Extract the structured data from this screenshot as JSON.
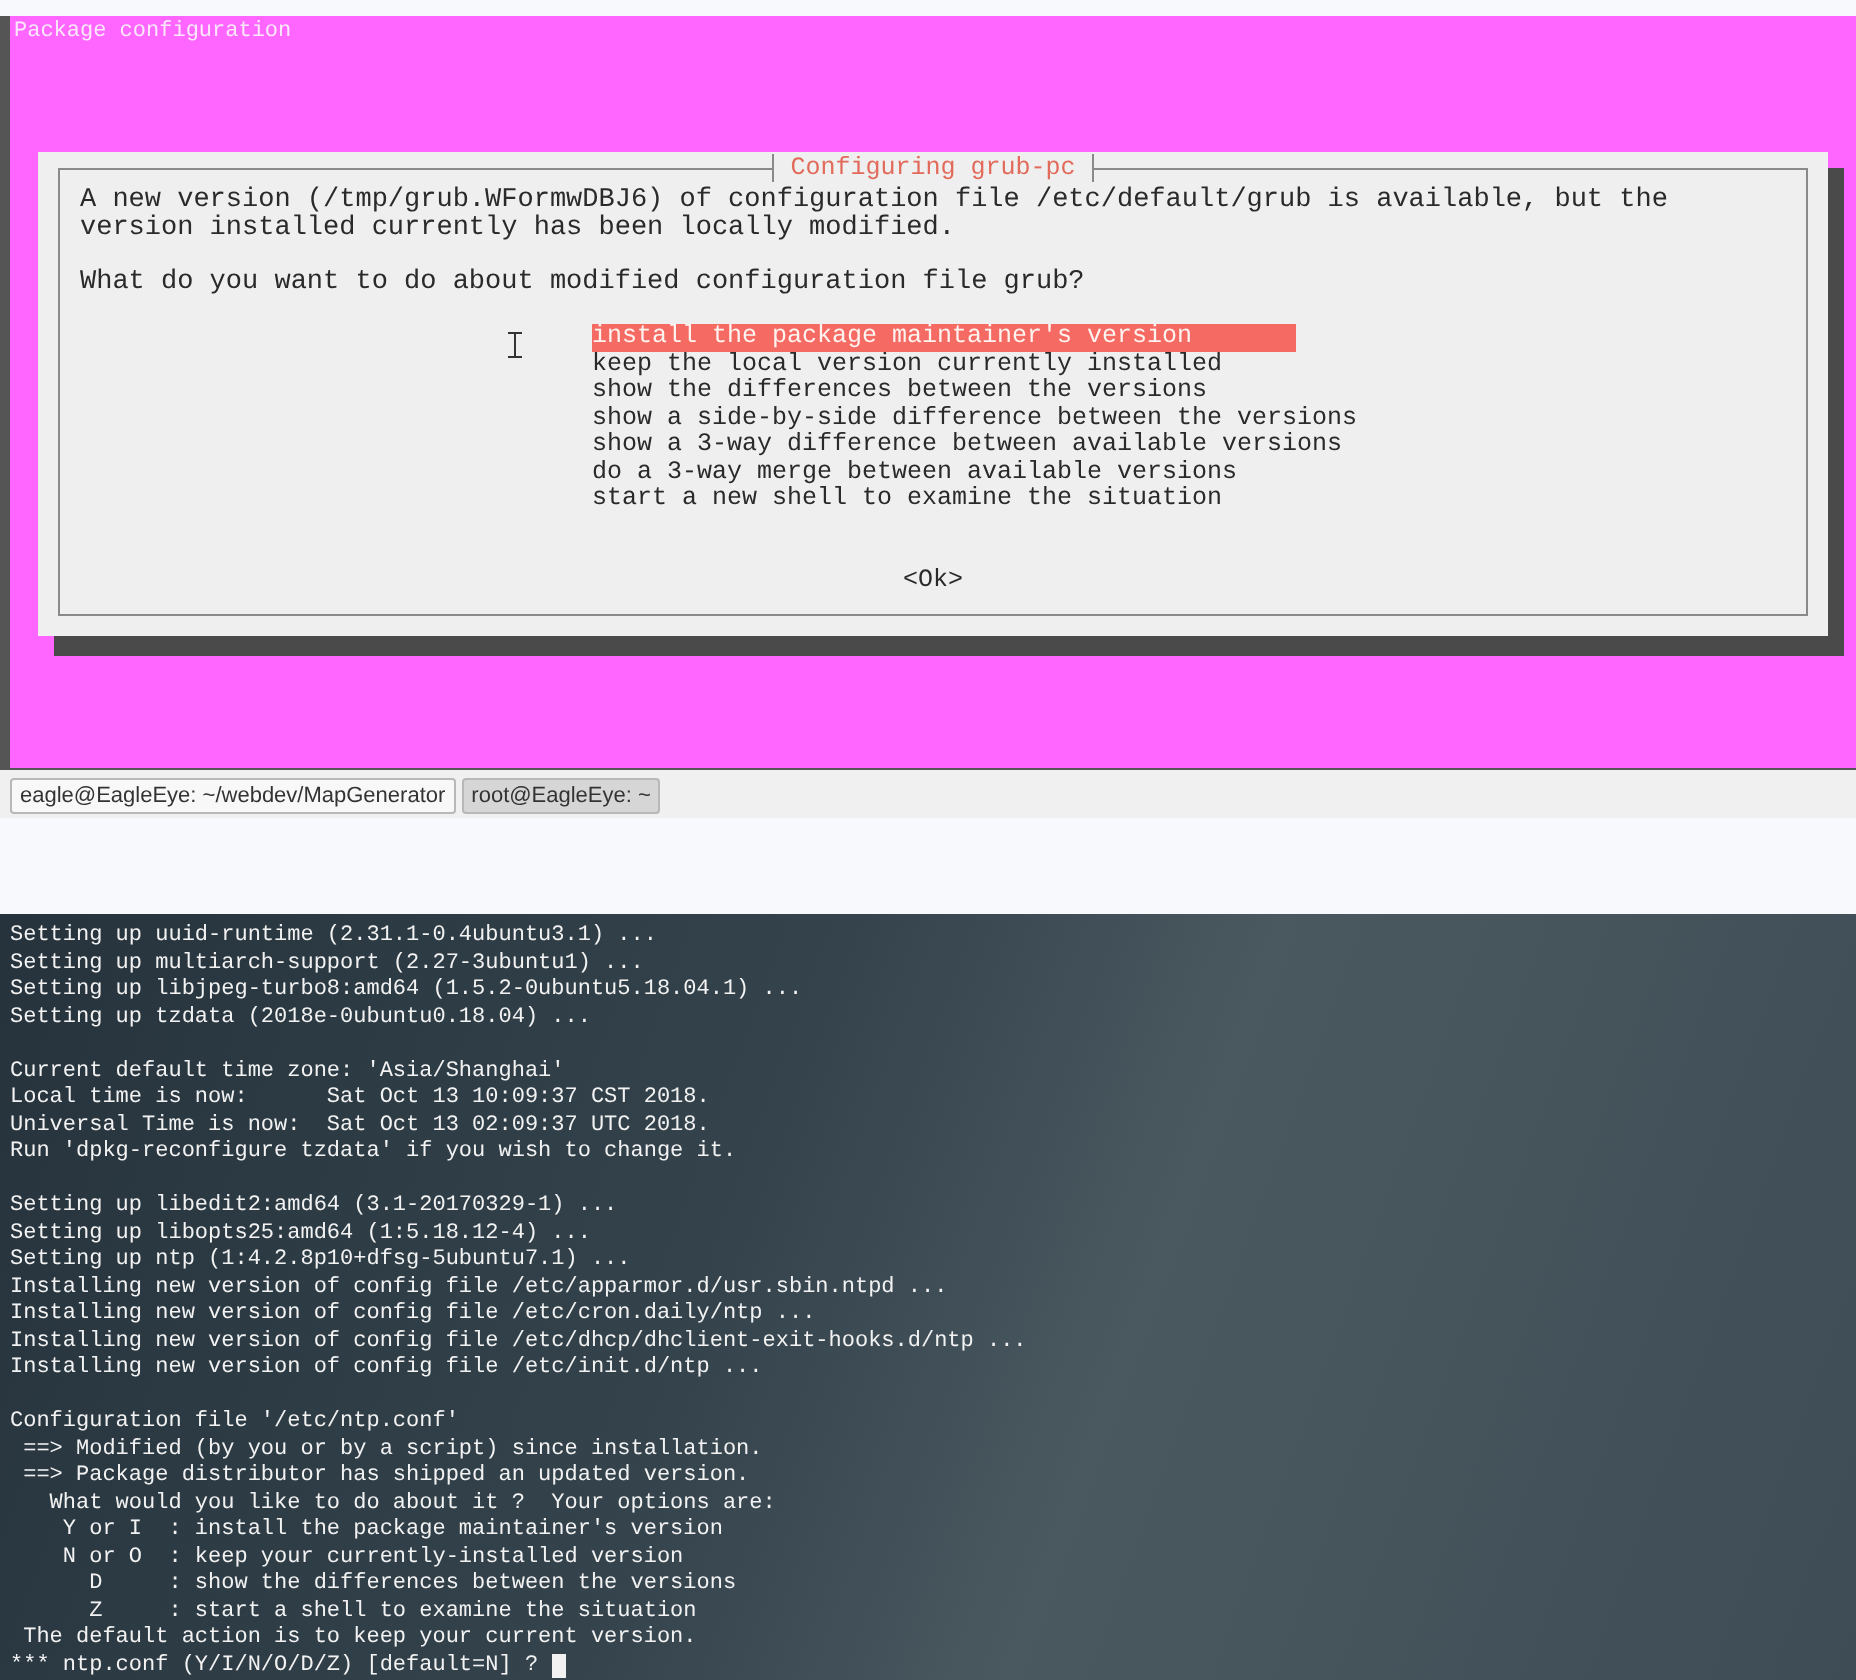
{
  "dialog_screen": {
    "title": "Package configuration",
    "dialog": {
      "title": "Configuring grub-pc",
      "message": "A new version (/tmp/grub.WFormwDBJ6) of configuration file /etc/default/grub is available, but the version installed currently has been locally modified.",
      "question": "What do you want to do about modified configuration file grub?",
      "options": [
        {
          "label": "install the package maintainer's version",
          "selected": true
        },
        {
          "label": "keep the local version currently installed",
          "selected": false
        },
        {
          "label": "show the differences between the versions",
          "selected": false
        },
        {
          "label": "show a side-by-side difference between the versions",
          "selected": false
        },
        {
          "label": "show a 3-way difference between available versions",
          "selected": false
        },
        {
          "label": "do a 3-way merge between available versions",
          "selected": false
        },
        {
          "label": "start a new shell to examine the situation",
          "selected": false
        }
      ],
      "ok_button": "<Ok>"
    }
  },
  "taskbar": {
    "items": [
      {
        "label": "eagle@EagleEye: ~/webdev/MapGenerator",
        "selected": false
      },
      {
        "label": "root@EagleEye: ~",
        "selected": true
      }
    ]
  },
  "terminal": {
    "paragraphs": [
      [
        "Setting up uuid-runtime (2.31.1-0.4ubuntu3.1) ...",
        "Setting up multiarch-support (2.27-3ubuntu1) ...",
        "Setting up libjpeg-turbo8:amd64 (1.5.2-0ubuntu5.18.04.1) ...",
        "Setting up tzdata (2018e-0ubuntu0.18.04) ..."
      ],
      [
        "Current default time zone: 'Asia/Shanghai'",
        "Local time is now:      Sat Oct 13 10:09:37 CST 2018.",
        "Universal Time is now:  Sat Oct 13 02:09:37 UTC 2018.",
        "Run 'dpkg-reconfigure tzdata' if you wish to change it."
      ],
      [
        "Setting up libedit2:amd64 (3.1-20170329-1) ...",
        "Setting up libopts25:amd64 (1:5.18.12-4) ...",
        "Setting up ntp (1:4.2.8p10+dfsg-5ubuntu7.1) ...",
        "Installing new version of config file /etc/apparmor.d/usr.sbin.ntpd ...",
        "Installing new version of config file /etc/cron.daily/ntp ...",
        "Installing new version of config file /etc/dhcp/dhclient-exit-hooks.d/ntp ...",
        "Installing new version of config file /etc/init.d/ntp ..."
      ],
      [
        "Configuration file '/etc/ntp.conf'",
        " ==> Modified (by you or by a script) since installation.",
        " ==> Package distributor has shipped an updated version.",
        "   What would you like to do about it ?  Your options are:",
        "    Y or I  : install the package maintainer's version",
        "    N or O  : keep your currently-installed version",
        "      D     : show the differences between the versions",
        "      Z     : start a shell to examine the situation",
        " The default action is to keep your current version."
      ]
    ],
    "prompt": "*** ntp.conf (Y/I/N/O/D/Z) [default=N] ?"
  }
}
